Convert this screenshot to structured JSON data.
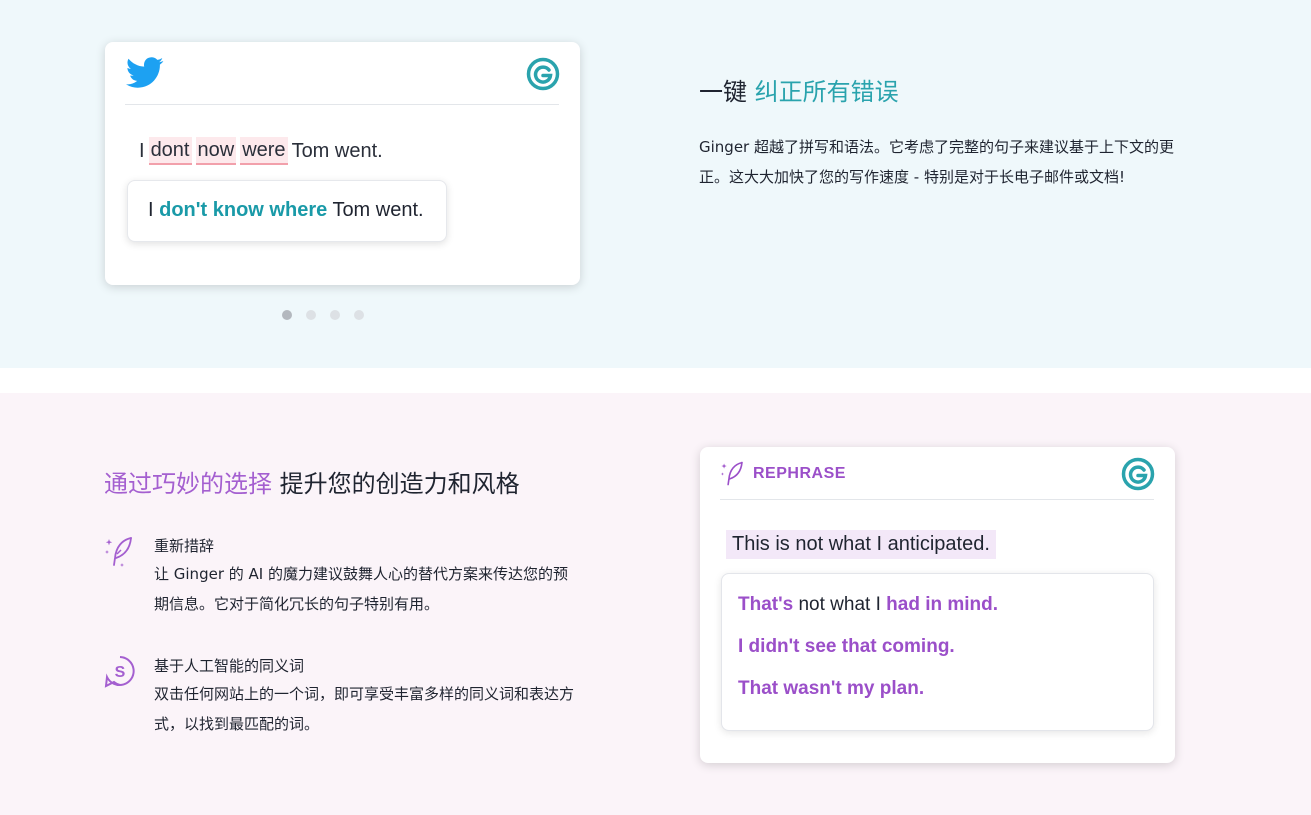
{
  "colors": {
    "teal_accent": "#2aa3ad",
    "purple_accent": "#a45fd0",
    "error_highlight": "#fde9ec",
    "top_bg": "#eff8fb",
    "bottom_bg": "#fbf4f9"
  },
  "icons": {
    "twitter": "twitter-icon",
    "ginger": "ginger-g-icon",
    "quill": "quill-sparkle-icon",
    "synonym": "synonym-s-icon"
  },
  "correction_card": {
    "wrong_sentence": {
      "prefix": "I",
      "errors": [
        "dont",
        "now",
        "were"
      ],
      "suffix": "Tom went."
    },
    "suggestion": {
      "prefix": "I",
      "highlight": "don't know where",
      "suffix": "Tom went."
    }
  },
  "carousel": {
    "dot_count": 4,
    "active_index": 0
  },
  "feature_correct": {
    "heading_plain": "一键",
    "heading_accent": "纠正所有错误",
    "description": "Ginger 超越了拼写和语法。它考虑了完整的句子来建议基于上下文的更正。这大大加快了您的写作速度 - 特别是对于长电子邮件或文档!"
  },
  "feature_style": {
    "heading_accent": "通过巧妙的选择",
    "heading_plain": "提升您的创造力和风格",
    "items": [
      {
        "title": "重新措辞",
        "description": "让 Ginger 的 AI 的魔力建议鼓舞人心的替代方案来传达您的预期信息。它对于简化冗长的句子特别有用。"
      },
      {
        "title": "基于人工智能的同义词",
        "description": "双击任何网站上的一个词，即可享受丰富多样的同义词和表达方式，以找到最匹配的词。"
      }
    ]
  },
  "rephrase_card": {
    "label": "REPHRASE",
    "original": "This is not what I anticipated.",
    "options": [
      {
        "a": "That's",
        "b": " not what I ",
        "c": "had in mind."
      },
      {
        "a": "I didn't see that coming.",
        "b": "",
        "c": ""
      },
      {
        "a": "That wasn't my plan.",
        "b": "",
        "c": ""
      }
    ]
  }
}
